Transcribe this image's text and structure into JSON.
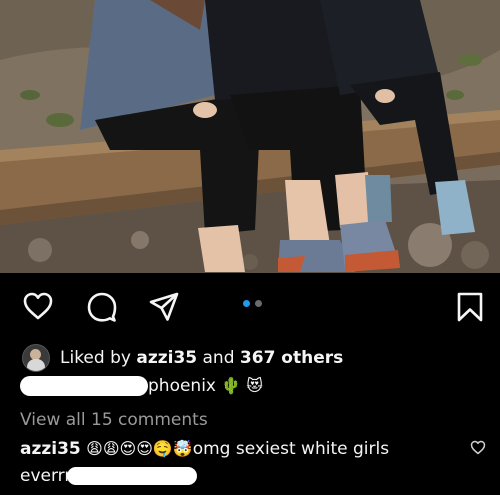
{
  "post": {
    "image_alt": "Three people sitting on a wooden log railing on a rocky hillside"
  },
  "actions": {
    "like_icon": "heart-icon",
    "comment_icon": "comment-bubble-icon",
    "share_icon": "paper-plane-icon",
    "save_icon": "bookmark-icon"
  },
  "carousel": {
    "count": 2,
    "active_index": 0
  },
  "likes": {
    "prefix": "Liked by",
    "user": "azzi35",
    "connector": "and",
    "others": "367 others"
  },
  "caption": {
    "text": "phoenix",
    "emojis": "🌵 😻"
  },
  "comments": {
    "view_all": "View all 15 comments",
    "first": {
      "user": "azzi35",
      "emojis": "😩😩😍😍🤤🤯",
      "text": "omg sexiest white girls",
      "continuation": "everrr"
    }
  },
  "colors": {
    "background": "#000000",
    "text": "#f5f5f5",
    "muted": "#9a9a9a",
    "accent_dot": "#1d9bf0"
  }
}
